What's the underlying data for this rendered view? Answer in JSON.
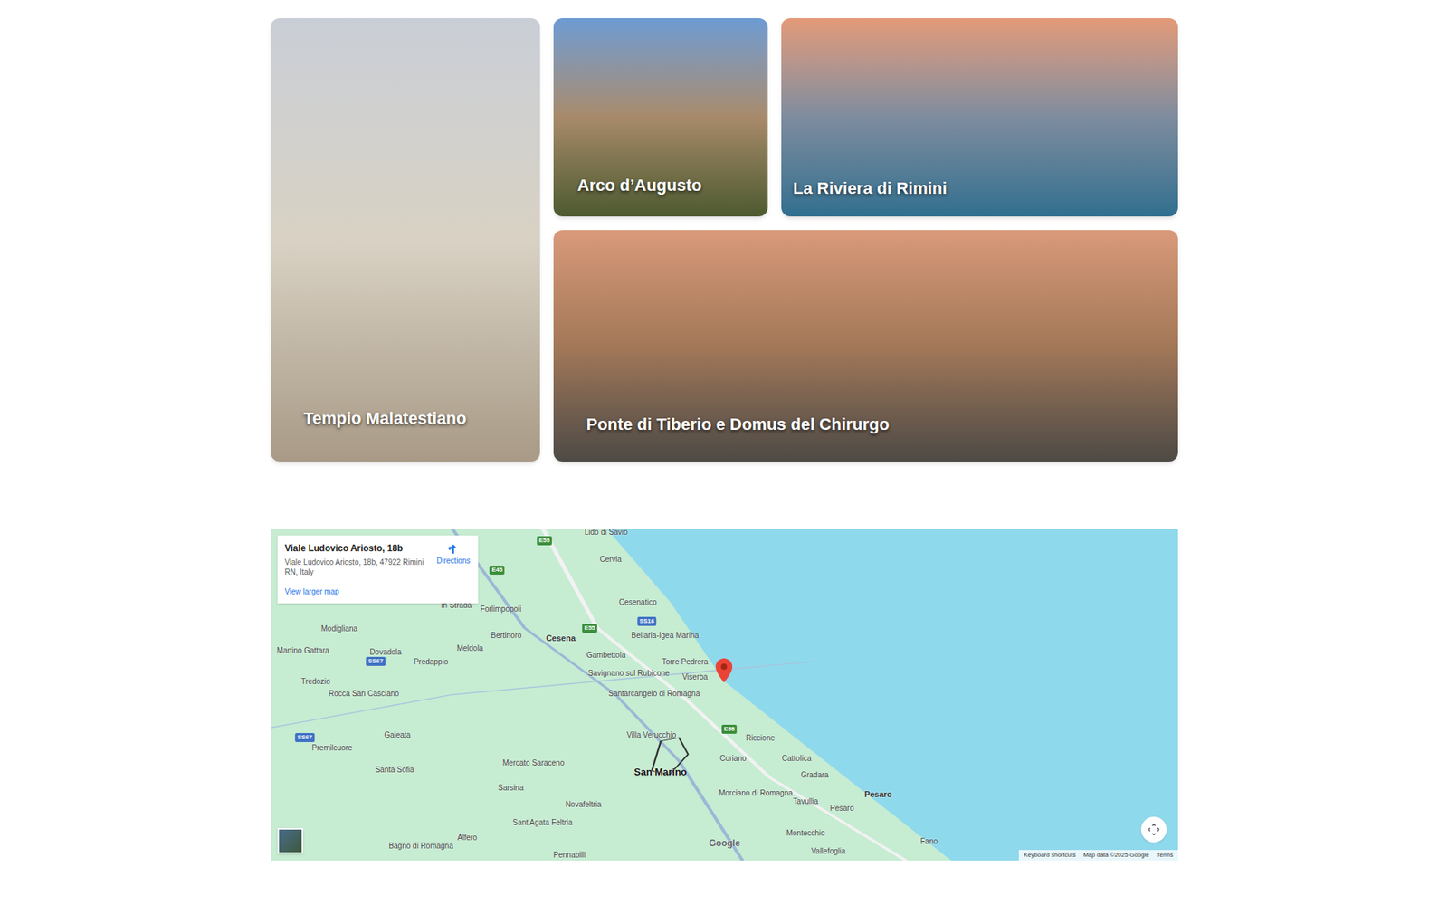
{
  "attractions": [
    {
      "name": "Tempio Malatestiano"
    },
    {
      "name": "Arco d’Augusto"
    },
    {
      "name": "La Riviera di Rimini"
    },
    {
      "name": "Ponte di Tiberio e Domus del Chirurgo"
    }
  ],
  "map": {
    "info_card": {
      "title": "Viale Ludovico Ariosto, 18b",
      "address": "Viale Ludovico Ariosto, 18b, 47922 Rimini RN, Italy",
      "directions": "Directions",
      "larger_map": "View larger map"
    },
    "places": [
      {
        "name": "Lido di Savio",
        "kind": "town"
      },
      {
        "name": "Cervia",
        "kind": "town"
      },
      {
        "name": "Cesenatico",
        "kind": "town"
      },
      {
        "name": "Bellaria-Igea Marina",
        "kind": "town"
      },
      {
        "name": "Torre Pedrera",
        "kind": "town"
      },
      {
        "name": "Viserba",
        "kind": "town"
      },
      {
        "name": "Savignano sul Rubicone",
        "kind": "town"
      },
      {
        "name": "Santarcangelo di Romagna",
        "kind": "town"
      },
      {
        "name": "Cesena",
        "kind": "city"
      },
      {
        "name": "Gambettola",
        "kind": "town"
      },
      {
        "name": "Bertinoro",
        "kind": "town"
      },
      {
        "name": "Forlimpopoli",
        "kind": "town"
      },
      {
        "name": "In Strada",
        "kind": "town"
      },
      {
        "name": "Modigliana",
        "kind": "town"
      },
      {
        "name": "Dovadola",
        "kind": "town"
      },
      {
        "name": "Meldola",
        "kind": "town"
      },
      {
        "name": "Predappio",
        "kind": "town"
      },
      {
        "name": "Tredozio",
        "kind": "town"
      },
      {
        "name": "Rocca San Casciano",
        "kind": "town"
      },
      {
        "name": "Galeata",
        "kind": "town"
      },
      {
        "name": "Premilcuore",
        "kind": "town"
      },
      {
        "name": "Santa Sofia",
        "kind": "town"
      },
      {
        "name": "Villa Verucchio",
        "kind": "town"
      },
      {
        "name": "Riccione",
        "kind": "town"
      },
      {
        "name": "San Marino",
        "kind": "country"
      },
      {
        "name": "Coriano",
        "kind": "town"
      },
      {
        "name": "Cattolica",
        "kind": "town"
      },
      {
        "name": "Gradara",
        "kind": "town"
      },
      {
        "name": "Mercato Saraceno",
        "kind": "town"
      },
      {
        "name": "Sarsina",
        "kind": "town"
      },
      {
        "name": "Novafeltria",
        "kind": "town"
      },
      {
        "name": "Morciano di Romagna",
        "kind": "town"
      },
      {
        "name": "Tavullia",
        "kind": "town"
      },
      {
        "name": "Pesaro",
        "kind": "city"
      },
      {
        "name": "Pesaro",
        "kind": "town"
      },
      {
        "name": "Sant'Agata Feltria",
        "kind": "town"
      },
      {
        "name": "Montecchio",
        "kind": "town"
      },
      {
        "name": "Vallefoglia",
        "kind": "town"
      },
      {
        "name": "Fano",
        "kind": "town"
      },
      {
        "name": "Bagno di Romagna",
        "kind": "town"
      },
      {
        "name": "Alfero",
        "kind": "town"
      },
      {
        "name": "Pennabilli",
        "kind": "town"
      },
      {
        "name": "Martino Gattara",
        "kind": "town"
      }
    ],
    "roads": [
      {
        "label": "E55"
      },
      {
        "label": "E45"
      },
      {
        "label": "E55"
      },
      {
        "label": "SS16"
      },
      {
        "label": "SS67"
      },
      {
        "label": "SS67"
      },
      {
        "label": "E55"
      }
    ],
    "logo": "Google",
    "attribution": [
      "Keyboard shortcuts",
      "Map data ©2025 Google",
      "Terms"
    ]
  }
}
